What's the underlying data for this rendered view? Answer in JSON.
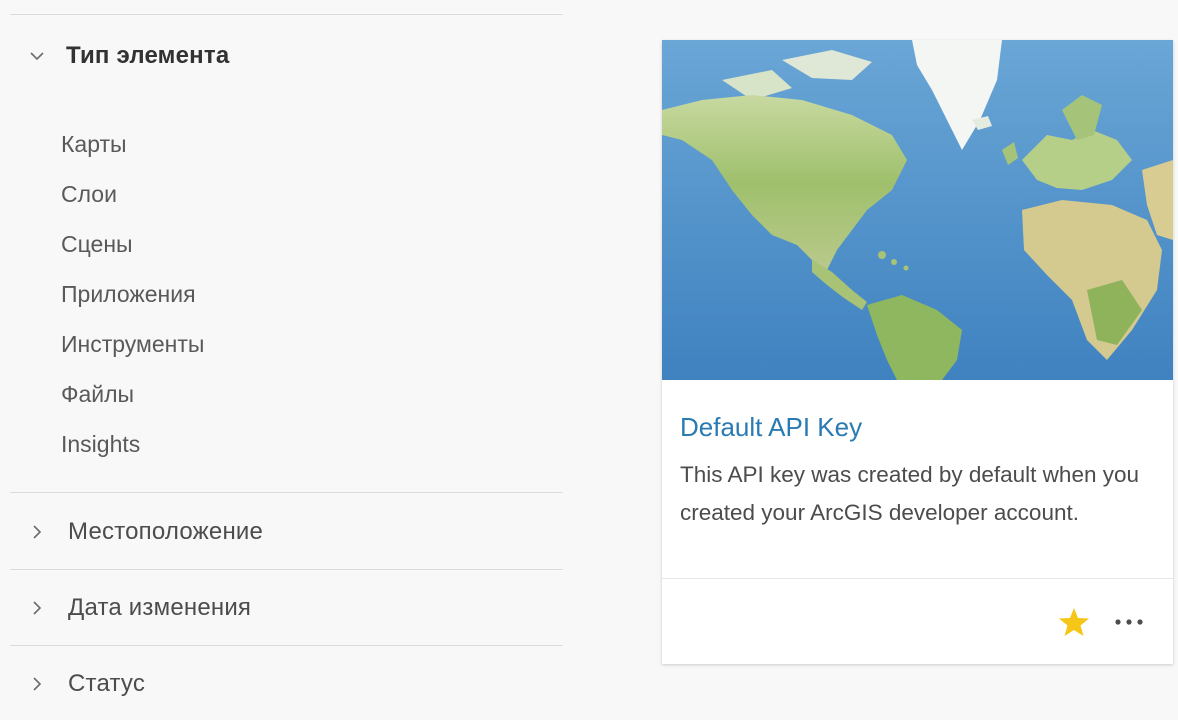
{
  "filters": {
    "item_type": {
      "title": "Тип элемента",
      "expanded": true,
      "options": [
        "Карты",
        "Слои",
        "Сцены",
        "Приложения",
        "Инструменты",
        "Файлы",
        "Insights"
      ]
    },
    "location": {
      "title": "Местоположение",
      "expanded": false
    },
    "date_modified": {
      "title": "Дата изменения",
      "expanded": false
    },
    "status": {
      "title": "Статус",
      "expanded": false
    }
  },
  "card": {
    "thumbnail_icon": "world-map-thumbnail",
    "title": "Default API Key",
    "description": "This API key was created by default when you created your ArcGIS developer account.",
    "favorite": true,
    "favorite_color": "#f5c518",
    "more_icon": "ellipsis-icon"
  },
  "colors": {
    "link": "#2a7ab3",
    "background": "#f8f8f8",
    "card": "#ffffff",
    "ocean": "#4a8cc7",
    "land": "#a9c97a"
  }
}
